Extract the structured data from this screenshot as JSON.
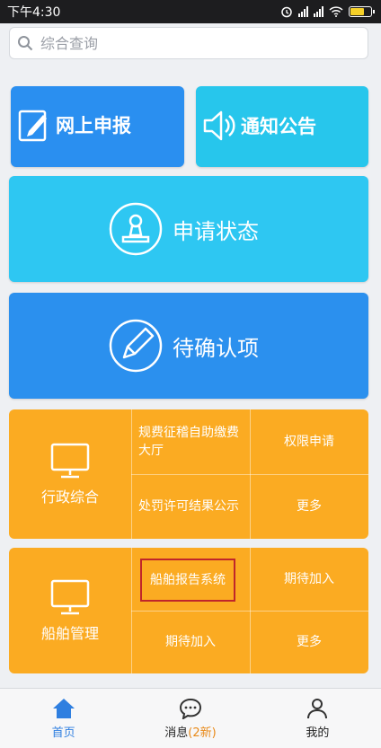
{
  "status_bar": {
    "time": "下午4:30",
    "battery_color": "#f5d028"
  },
  "search": {
    "placeholder": "综合查询"
  },
  "tiles": {
    "online_report": {
      "label": "网上申报",
      "color": "#2a8ff0"
    },
    "notice": {
      "label": "通知公告",
      "color": "#27c6ec"
    },
    "apply_status": {
      "label": "申请状态",
      "color": "#2ec7f2"
    },
    "pending": {
      "label": "待确认项",
      "color": "#2b90ee"
    }
  },
  "admin_panel": {
    "title": "行政综合",
    "color": "#fbab22",
    "items": {
      "fee_hall": "规费征稽自助缴费大厅",
      "permission": "权限申请",
      "penalty": "处罚许可结果公示",
      "more": "更多"
    }
  },
  "ship_panel": {
    "title": "船舶管理",
    "items": {
      "ship_report": "船舶报告系统",
      "coming_1": "期待加入",
      "coming_2": "期待加入",
      "more": "更多"
    }
  },
  "tabbar": {
    "home": "首页",
    "messages": "消息",
    "messages_badge": "(2新)",
    "mine": "我的",
    "active_color": "#2f7fe0"
  }
}
